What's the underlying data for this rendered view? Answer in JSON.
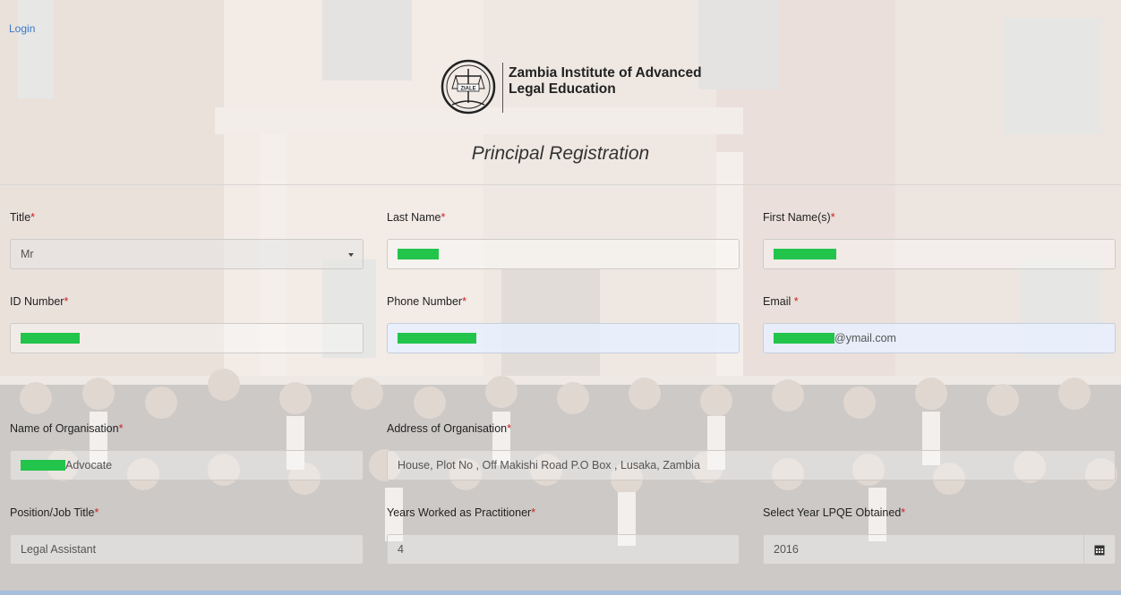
{
  "header": {
    "login_link": "Login",
    "brand_line1": "Zambia Institute of Advanced",
    "brand_line2": "Legal Education",
    "logo_text": "ZIALE",
    "page_title": "Principal Registration"
  },
  "required_marker": "*",
  "form": {
    "title": {
      "label": "Title",
      "value": "Mr"
    },
    "last_name": {
      "label": "Last Name"
    },
    "first_name": {
      "label": "First Name(s)"
    },
    "id_number": {
      "label": "ID Number"
    },
    "phone_number": {
      "label": "Phone Number"
    },
    "email": {
      "label": "Email ",
      "value_suffix": "@ymail.com"
    },
    "org_name": {
      "label": "Name of Organisation",
      "value_suffix": "Advocate"
    },
    "org_address": {
      "label": "Address of Organisation",
      "value": "House, Plot No , Off Makishi Road  P.O Box , Lusaka, Zambia"
    },
    "position": {
      "label": "Position/Job Title",
      "value": "Legal Assistant"
    },
    "years_worked": {
      "label": "Years Worked as Practitioner",
      "value": "4"
    },
    "lpqe_year": {
      "label": "Select Year LPQE Obtained",
      "value": "2016"
    }
  },
  "colors": {
    "link": "#3a78c7",
    "required": "#cc2222",
    "redaction": "#22c44b",
    "autofill_bg": "#e8f0fe"
  }
}
